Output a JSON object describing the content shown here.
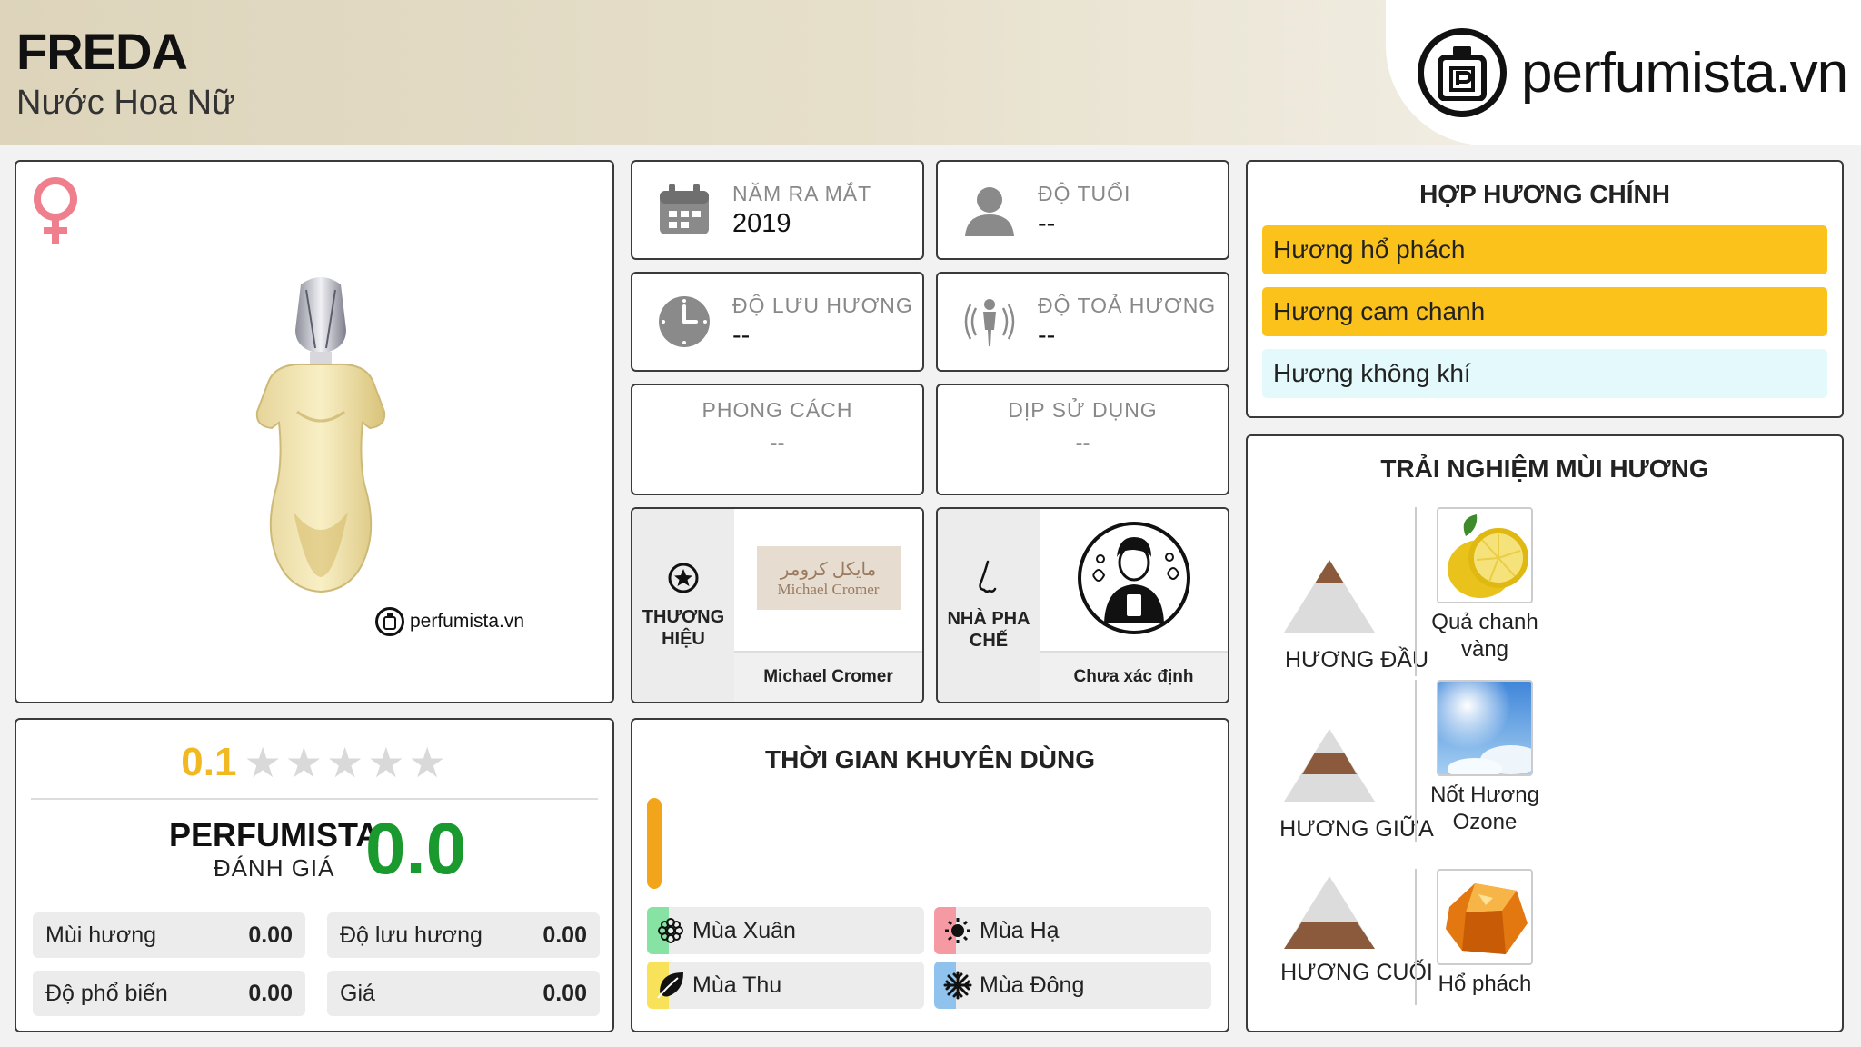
{
  "header": {
    "name": "FREDA",
    "subtitle": "Nước Hoa Nữ",
    "logo_text": "perfumista.vn"
  },
  "product": {
    "gender_icon": "female-symbol-icon",
    "watermark": "perfumista.vn"
  },
  "info": {
    "launch_year_label": "NĂM RA MẮT",
    "launch_year_value": "2019",
    "age_label": "ĐỘ TUỔI",
    "age_value": "--",
    "longevity_label": "ĐỘ LƯU HƯƠNG",
    "longevity_value": "--",
    "sillage_label": "ĐỘ TOẢ HƯƠNG",
    "sillage_value": "--",
    "style_label": "PHONG CÁCH",
    "style_value": "--",
    "occasion_label": "DỊP SỬ DỤNG",
    "occasion_value": "--"
  },
  "brand": {
    "label": "THƯƠNG HIỆU",
    "logo_ar": "مايكل كرومر",
    "logo_en": "Michael Cromer",
    "name": "Michael Cromer"
  },
  "perfumer": {
    "label": "NHÀ PHA CHẾ",
    "name": "Chưa xác định"
  },
  "accords": {
    "title": "HỢP HƯƠNG CHÍNH",
    "items": [
      {
        "label": "Hương hổ phách",
        "color": "#fcc21c"
      },
      {
        "label": "Hương cam chanh",
        "color": "#fcc21c"
      },
      {
        "label": "Hương không khí",
        "color": "#e3f9fb"
      }
    ]
  },
  "rating": {
    "score": "0.1",
    "stars_total": 5,
    "perfumista_label": "PERFUMISTA",
    "perfumista_sub": "ĐÁNH GIÁ",
    "perfumista_score": "0.0",
    "metrics": [
      {
        "label": "Mùi hương",
        "value": "0.00"
      },
      {
        "label": "Độ lưu hương",
        "value": "0.00"
      },
      {
        "label": "Độ phổ biến",
        "value": "0.00"
      },
      {
        "label": "Giá",
        "value": "0.00"
      }
    ]
  },
  "season": {
    "title": "THỜI GIAN KHUYÊN DÙNG",
    "items": [
      {
        "label": "Mùa Xuân",
        "icon": "flower-icon",
        "color": "#86e3a3"
      },
      {
        "label": "Mùa Hạ",
        "icon": "sun-icon",
        "color": "#f59aa3"
      },
      {
        "label": "Mùa Thu",
        "icon": "leaf-icon",
        "color": "#f7e25a"
      },
      {
        "label": "Mùa Đông",
        "icon": "snowflake-icon",
        "color": "#8fc3ee"
      }
    ]
  },
  "notes": {
    "title": "TRẢI NGHIỆM MÙI HƯƠNG",
    "rows": [
      {
        "label": "HƯƠNG ĐẦU",
        "note": "Quả chanh vàng"
      },
      {
        "label": "HƯƠNG GIỮA",
        "note": "Nốt Hương Ozone"
      },
      {
        "label": "HƯƠNG CUỐI",
        "note": "Hổ phách"
      }
    ]
  }
}
